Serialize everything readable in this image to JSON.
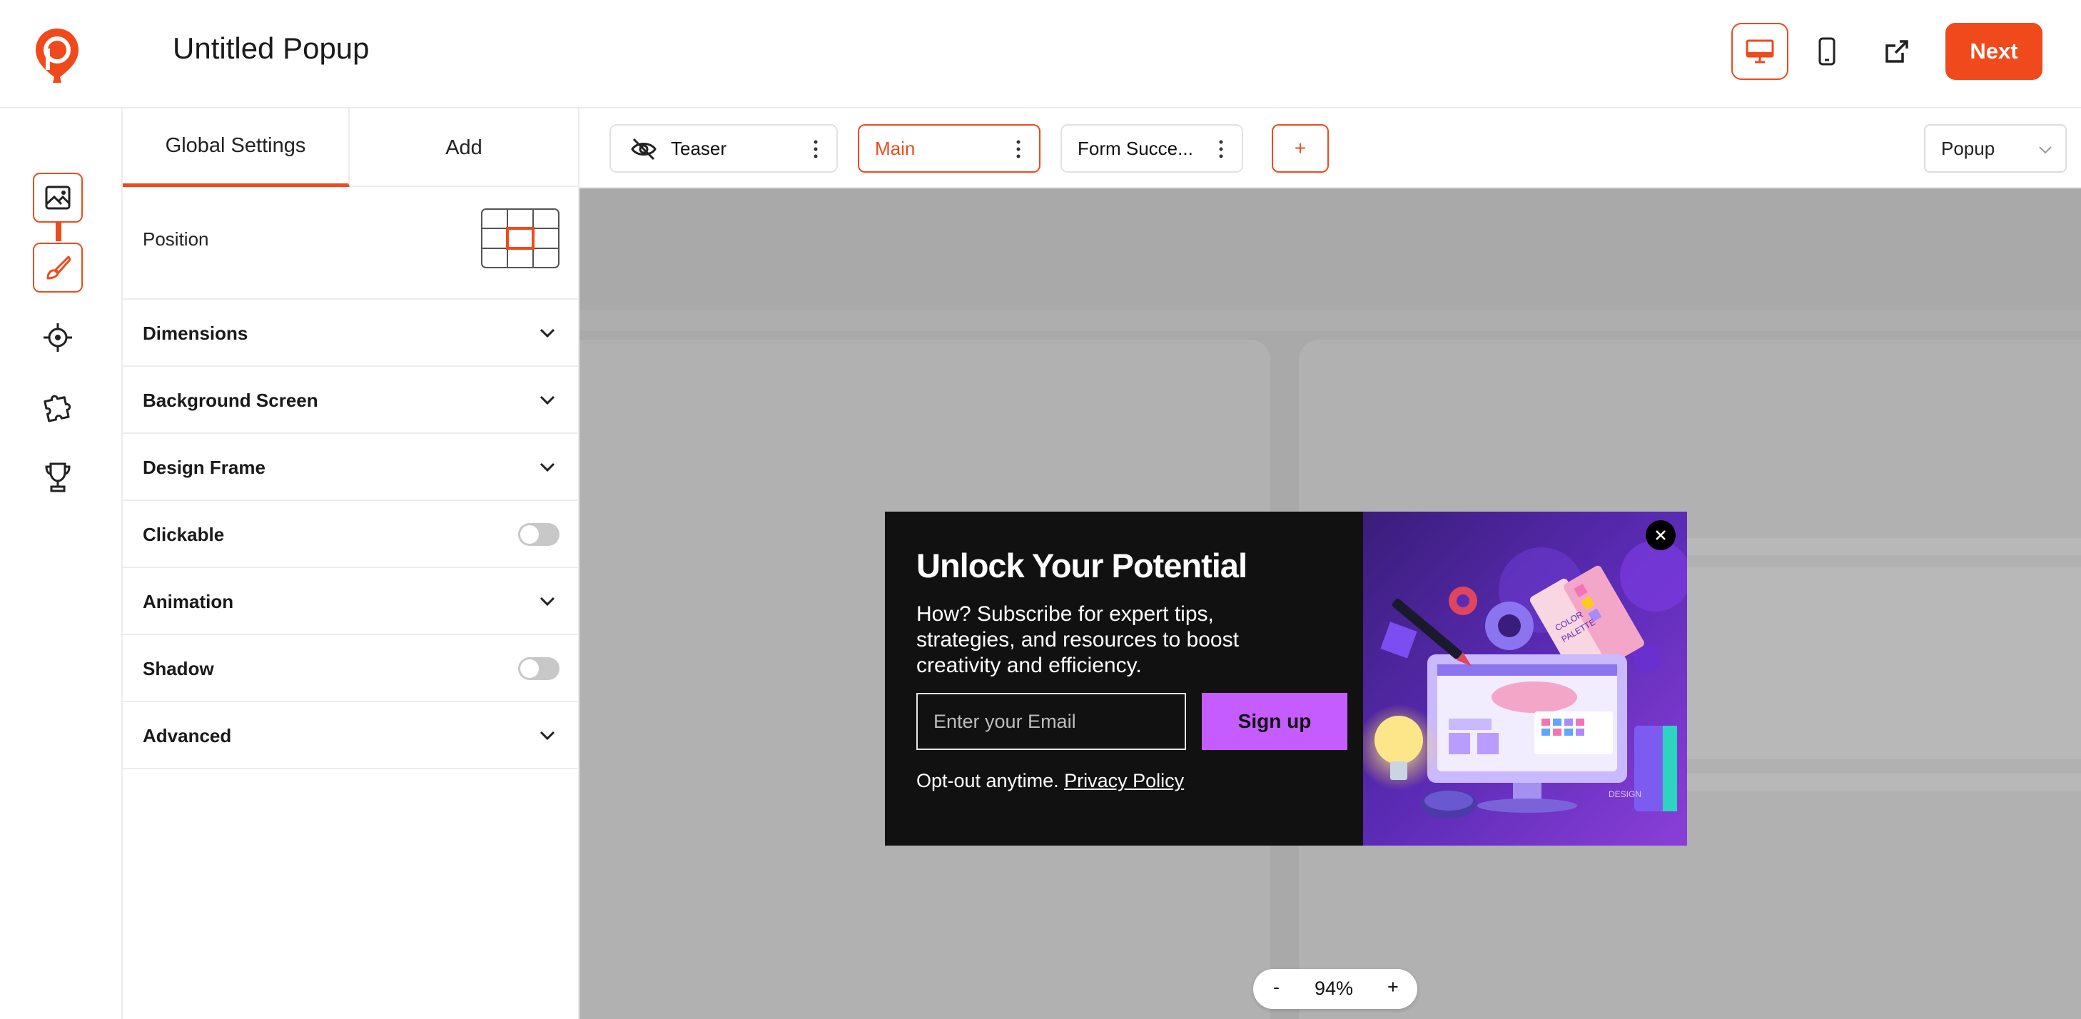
{
  "header": {
    "title": "Untitled Popup",
    "logo_icon": "balloon-p-logo",
    "devices": [
      "desktop-icon",
      "mobile-icon"
    ],
    "preview_icon": "external-link-icon",
    "next_label": "Next"
  },
  "rail": {
    "items": [
      "image-icon",
      "brush-icon",
      "target-icon",
      "puzzle-icon",
      "trophy-icon"
    ]
  },
  "panel": {
    "tabs": [
      "Global Settings",
      "Add"
    ],
    "position_label": "Position",
    "sections": [
      {
        "label": "Dimensions",
        "control": "chevron"
      },
      {
        "label": "Background Screen",
        "control": "chevron"
      },
      {
        "label": "Design Frame",
        "control": "chevron"
      },
      {
        "label": "Clickable",
        "control": "toggle",
        "on": false
      },
      {
        "label": "Animation",
        "control": "chevron"
      },
      {
        "label": "Shadow",
        "control": "toggle",
        "on": false
      },
      {
        "label": "Advanced",
        "control": "chevron"
      }
    ]
  },
  "steps": {
    "teaser": "Teaser",
    "main": "Main",
    "success": "Form Succe...",
    "add": "+",
    "type_select": "Popup"
  },
  "popup": {
    "heading": "Unlock Your Potential",
    "body": "How? Subscribe for expert tips, strategies, and resources to boost creativity and efficiency.",
    "email_placeholder": "Enter your Email",
    "signup_label": "Sign up",
    "optout": "Opt-out anytime.",
    "privacy": "Privacy Policy",
    "close_icon": "close-icon",
    "art_labels": [
      "COLOR",
      "PALETTE",
      "DESIGN"
    ]
  },
  "zoom": {
    "minus": "-",
    "value": "94%",
    "plus": "+"
  },
  "colors": {
    "accent": "#f04a1c",
    "signup": "#c55cff",
    "canvas": "#a9a9a9"
  }
}
